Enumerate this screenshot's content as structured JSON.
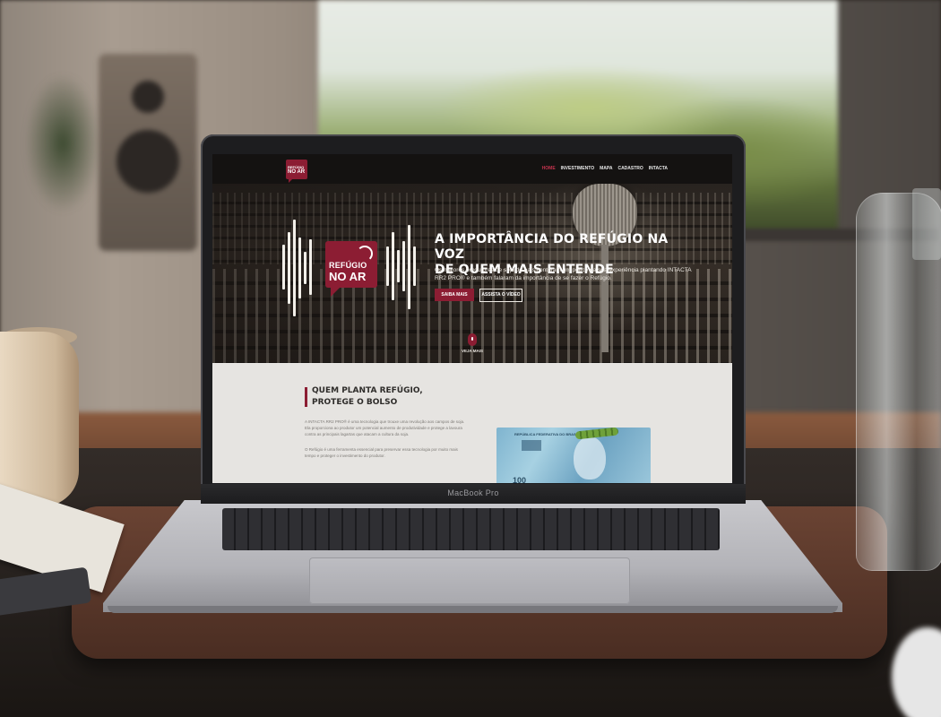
{
  "device": {
    "model_label": "MacBook Pro"
  },
  "site": {
    "logo": {
      "line1": "REFÚGIO",
      "line2": "NO AR"
    },
    "nav": [
      {
        "label": "HOME",
        "active": true
      },
      {
        "label": "INVESTIMENTO",
        "active": false
      },
      {
        "label": "MAPA",
        "active": false
      },
      {
        "label": "CADASTRO",
        "active": false
      },
      {
        "label": "INTACTA",
        "active": false
      }
    ],
    "hero": {
      "title": "A IMPORTÂNCIA DO REFÚGIO NA VOZ\nDE QUEM MAIS ENTENDE",
      "text": "Os maiores produtores de soja do país contaram um pouco da sua experiência plantando INTACTA RR2 PRO® e também falaram da importância de se fazer o Refúgio.",
      "primary_button": "SAIBA MAIS",
      "secondary_button": "ASSISTA O VÍDEO",
      "see_more": "VEJA MAIS"
    },
    "section": {
      "title": "QUEM PLANTA REFÚGIO,\nPROTEGE O BOLSO",
      "paragraph1": "A INTACTA RR2 PRO® é uma tecnologia que trouxe uma revolução aos campos de soja. Ela proporciona ao produtor um potencial aumento de produtividade e protege a lavoura contra as principais lagartas que atacam a cultura da soja.",
      "paragraph2": "O Refúgio é uma ferramenta essencial para preservar essa tecnologia por muito mais tempo e proteger o investimento do produtor.",
      "banknote_label": "REPÚBLICA FEDERATIVA DO BRASIL",
      "banknote_value": "100"
    }
  },
  "colors": {
    "brand": "#8c1d33",
    "nav_bg": "#141211",
    "section_bg": "#e6e4e1"
  }
}
